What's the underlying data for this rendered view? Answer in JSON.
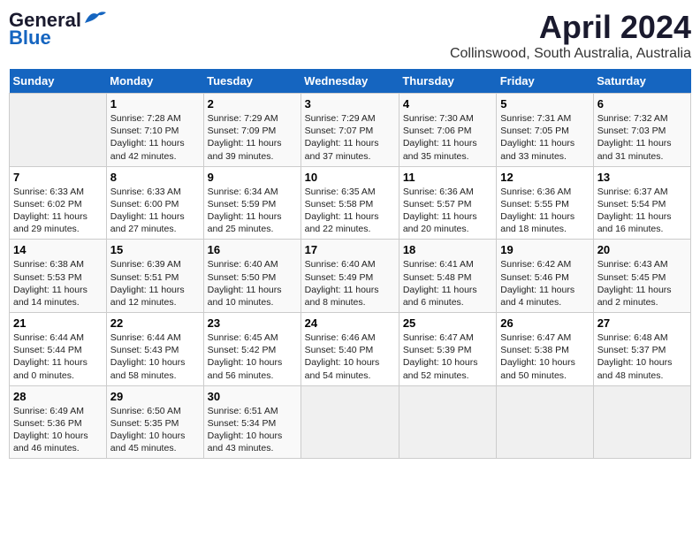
{
  "header": {
    "logo_line1": "General",
    "logo_line2": "Blue",
    "month": "April 2024",
    "location": "Collinswood, South Australia, Australia"
  },
  "days_of_week": [
    "Sunday",
    "Monday",
    "Tuesday",
    "Wednesday",
    "Thursday",
    "Friday",
    "Saturday"
  ],
  "weeks": [
    [
      {
        "num": "",
        "info": ""
      },
      {
        "num": "1",
        "info": "Sunrise: 7:28 AM\nSunset: 7:10 PM\nDaylight: 11 hours\nand 42 minutes."
      },
      {
        "num": "2",
        "info": "Sunrise: 7:29 AM\nSunset: 7:09 PM\nDaylight: 11 hours\nand 39 minutes."
      },
      {
        "num": "3",
        "info": "Sunrise: 7:29 AM\nSunset: 7:07 PM\nDaylight: 11 hours\nand 37 minutes."
      },
      {
        "num": "4",
        "info": "Sunrise: 7:30 AM\nSunset: 7:06 PM\nDaylight: 11 hours\nand 35 minutes."
      },
      {
        "num": "5",
        "info": "Sunrise: 7:31 AM\nSunset: 7:05 PM\nDaylight: 11 hours\nand 33 minutes."
      },
      {
        "num": "6",
        "info": "Sunrise: 7:32 AM\nSunset: 7:03 PM\nDaylight: 11 hours\nand 31 minutes."
      }
    ],
    [
      {
        "num": "7",
        "info": "Sunrise: 6:33 AM\nSunset: 6:02 PM\nDaylight: 11 hours\nand 29 minutes."
      },
      {
        "num": "8",
        "info": "Sunrise: 6:33 AM\nSunset: 6:00 PM\nDaylight: 11 hours\nand 27 minutes."
      },
      {
        "num": "9",
        "info": "Sunrise: 6:34 AM\nSunset: 5:59 PM\nDaylight: 11 hours\nand 25 minutes."
      },
      {
        "num": "10",
        "info": "Sunrise: 6:35 AM\nSunset: 5:58 PM\nDaylight: 11 hours\nand 22 minutes."
      },
      {
        "num": "11",
        "info": "Sunrise: 6:36 AM\nSunset: 5:57 PM\nDaylight: 11 hours\nand 20 minutes."
      },
      {
        "num": "12",
        "info": "Sunrise: 6:36 AM\nSunset: 5:55 PM\nDaylight: 11 hours\nand 18 minutes."
      },
      {
        "num": "13",
        "info": "Sunrise: 6:37 AM\nSunset: 5:54 PM\nDaylight: 11 hours\nand 16 minutes."
      }
    ],
    [
      {
        "num": "14",
        "info": "Sunrise: 6:38 AM\nSunset: 5:53 PM\nDaylight: 11 hours\nand 14 minutes."
      },
      {
        "num": "15",
        "info": "Sunrise: 6:39 AM\nSunset: 5:51 PM\nDaylight: 11 hours\nand 12 minutes."
      },
      {
        "num": "16",
        "info": "Sunrise: 6:40 AM\nSunset: 5:50 PM\nDaylight: 11 hours\nand 10 minutes."
      },
      {
        "num": "17",
        "info": "Sunrise: 6:40 AM\nSunset: 5:49 PM\nDaylight: 11 hours\nand 8 minutes."
      },
      {
        "num": "18",
        "info": "Sunrise: 6:41 AM\nSunset: 5:48 PM\nDaylight: 11 hours\nand 6 minutes."
      },
      {
        "num": "19",
        "info": "Sunrise: 6:42 AM\nSunset: 5:46 PM\nDaylight: 11 hours\nand 4 minutes."
      },
      {
        "num": "20",
        "info": "Sunrise: 6:43 AM\nSunset: 5:45 PM\nDaylight: 11 hours\nand 2 minutes."
      }
    ],
    [
      {
        "num": "21",
        "info": "Sunrise: 6:44 AM\nSunset: 5:44 PM\nDaylight: 11 hours\nand 0 minutes."
      },
      {
        "num": "22",
        "info": "Sunrise: 6:44 AM\nSunset: 5:43 PM\nDaylight: 10 hours\nand 58 minutes."
      },
      {
        "num": "23",
        "info": "Sunrise: 6:45 AM\nSunset: 5:42 PM\nDaylight: 10 hours\nand 56 minutes."
      },
      {
        "num": "24",
        "info": "Sunrise: 6:46 AM\nSunset: 5:40 PM\nDaylight: 10 hours\nand 54 minutes."
      },
      {
        "num": "25",
        "info": "Sunrise: 6:47 AM\nSunset: 5:39 PM\nDaylight: 10 hours\nand 52 minutes."
      },
      {
        "num": "26",
        "info": "Sunrise: 6:47 AM\nSunset: 5:38 PM\nDaylight: 10 hours\nand 50 minutes."
      },
      {
        "num": "27",
        "info": "Sunrise: 6:48 AM\nSunset: 5:37 PM\nDaylight: 10 hours\nand 48 minutes."
      }
    ],
    [
      {
        "num": "28",
        "info": "Sunrise: 6:49 AM\nSunset: 5:36 PM\nDaylight: 10 hours\nand 46 minutes."
      },
      {
        "num": "29",
        "info": "Sunrise: 6:50 AM\nSunset: 5:35 PM\nDaylight: 10 hours\nand 45 minutes."
      },
      {
        "num": "30",
        "info": "Sunrise: 6:51 AM\nSunset: 5:34 PM\nDaylight: 10 hours\nand 43 minutes."
      },
      {
        "num": "",
        "info": ""
      },
      {
        "num": "",
        "info": ""
      },
      {
        "num": "",
        "info": ""
      },
      {
        "num": "",
        "info": ""
      }
    ]
  ]
}
